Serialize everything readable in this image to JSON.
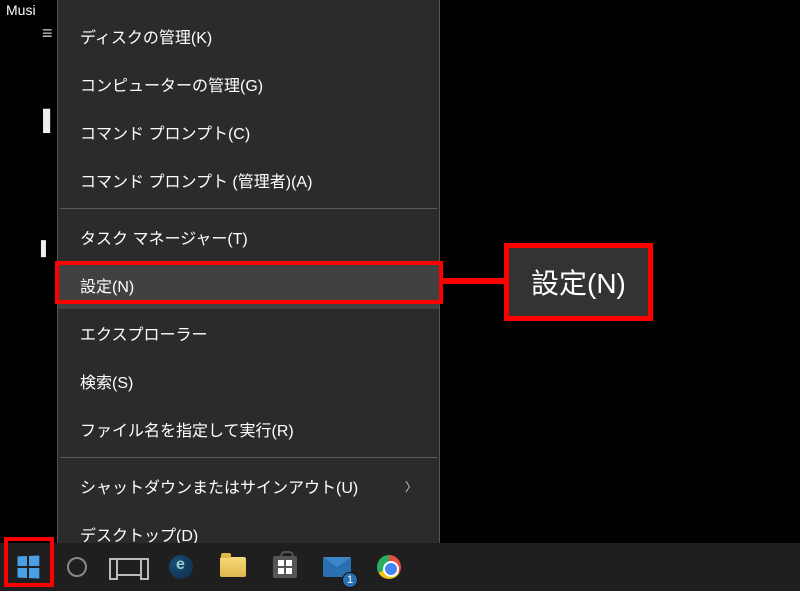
{
  "desktop": {
    "label_fragment": "Musi"
  },
  "menu": {
    "items": [
      {
        "label": "ディスクの管理(K)"
      },
      {
        "label": "コンピューターの管理(G)"
      },
      {
        "label": "コマンド プロンプト(C)"
      },
      {
        "label": "コマンド プロンプト (管理者)(A)"
      }
    ],
    "items2": [
      {
        "label": "タスク マネージャー(T)"
      },
      {
        "label": "設定(N)",
        "highlighted": true
      },
      {
        "label": "エクスプローラー"
      },
      {
        "label": "検索(S)"
      },
      {
        "label": "ファイル名を指定して実行(R)"
      }
    ],
    "items3": [
      {
        "label": "シャットダウンまたはサインアウト(U)",
        "has_submenu": true
      },
      {
        "label": "デスクトップ(D)"
      }
    ]
  },
  "callout": {
    "text": "設定(N)"
  },
  "taskbar": {
    "mail_badge": "1"
  },
  "colors": {
    "highlight": "#ff0000",
    "menu_bg": "#2b2b2b",
    "menu_hover": "#414141"
  }
}
